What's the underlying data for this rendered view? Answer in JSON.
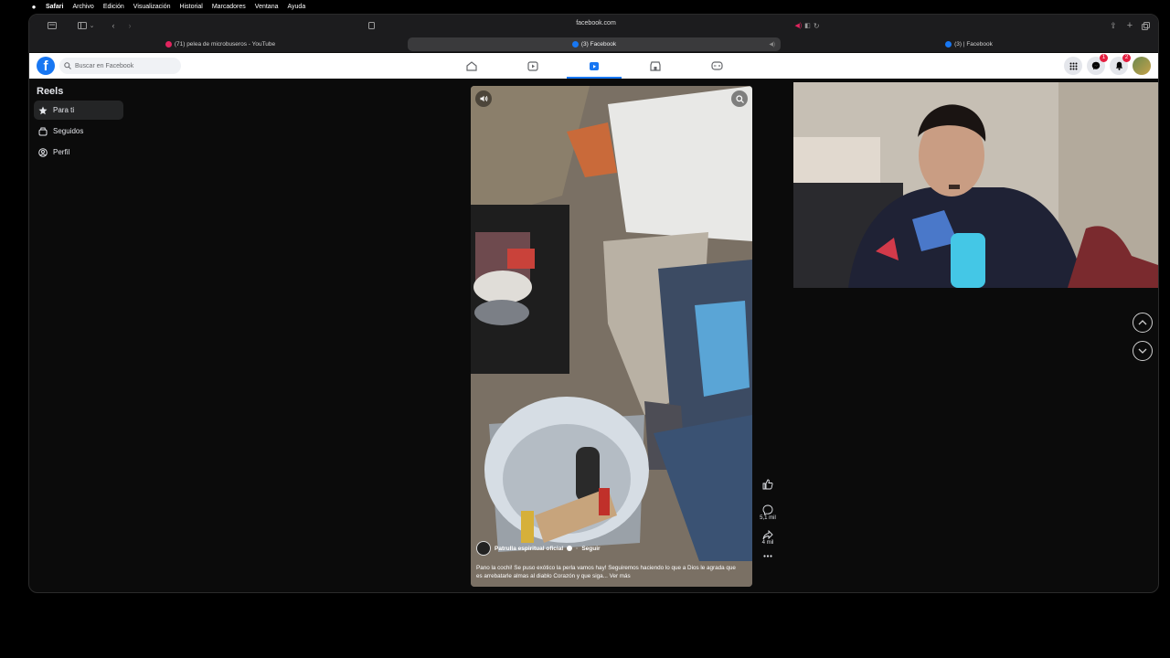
{
  "menubar": {
    "items": [
      "Safari",
      "Archivo",
      "Edición",
      "Visualización",
      "Historial",
      "Marcadores",
      "Ventana",
      "Ayuda"
    ]
  },
  "browser": {
    "url": "facebook.com",
    "tabs": [
      {
        "label": "(71) pelea de microbuseros - YouTube",
        "favicon": "youtube-icon"
      },
      {
        "label": "(3) Facebook",
        "favicon": "facebook-icon"
      },
      {
        "label": "(3) | Facebook",
        "favicon": "facebook-icon"
      }
    ]
  },
  "facebook": {
    "search_placeholder": "Buscar en Facebook",
    "nav": [
      "home-icon",
      "video-icon",
      "reels-icon",
      "marketplace-icon",
      "gaming-icon"
    ],
    "messenger_badge": "1",
    "notifications_badge": "2",
    "brand_color": "#1877f2"
  },
  "sidebar": {
    "title": "Reels",
    "items": [
      {
        "label": "Para ti",
        "icon": "star-icon"
      },
      {
        "label": "Seguidos",
        "icon": "following-icon"
      },
      {
        "label": "Perfil",
        "icon": "profile-icon"
      }
    ]
  },
  "reel": {
    "author": "Patrulla espiritual oficial",
    "follow": "Seguir",
    "caption": "Pano la cochi! Se puso exótico la perla vamos hay! Seguiremos haciendo lo que a Dios le agrada que es arrebatarle almas al diablo Corazón y que siga... Ver más",
    "comments": "5,1 mil",
    "shares": "4 mil"
  }
}
